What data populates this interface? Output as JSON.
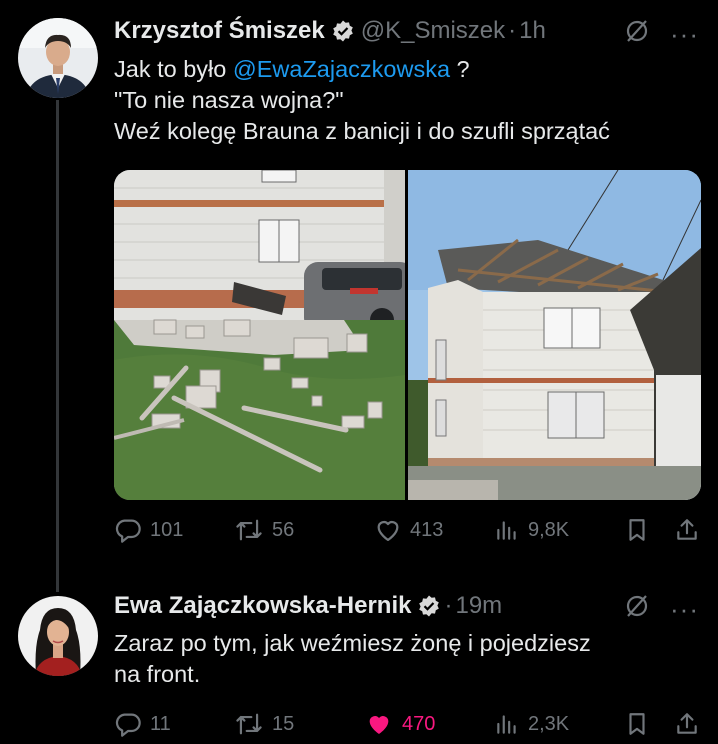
{
  "tweets": [
    {
      "author": "Krzysztof Śmiszek",
      "handle": "@K_Smiszek",
      "dot": "·",
      "time": "1h",
      "text": {
        "line1_pre": "Jak to było ",
        "line1_mention": "@EwaZajaczkowska",
        "line1_post": " ?",
        "line2": "\"To nie nasza wojna?\"",
        "line3": "Weź kolegę Brauna z banicji i do szufli sprzątać"
      },
      "stats": {
        "replies": "101",
        "reposts": "56",
        "likes": "413",
        "views": "9,8K"
      }
    },
    {
      "author": "Ewa Zajączkowska-Hernik",
      "dot": "·",
      "time": "19m",
      "text": {
        "line1": "Zaraz po tym, jak weźmiesz żonę i pojedziesz",
        "line2": "na front."
      },
      "stats": {
        "replies": "11",
        "reposts": "15",
        "likes": "470",
        "views": "2,3K"
      },
      "liked": true
    }
  ],
  "more_label": "···",
  "colors": {
    "accent": "#1d9bf0",
    "like": "#f91880",
    "muted": "#71767b",
    "text": "#e7e9ea",
    "background": "#000000"
  },
  "icons": [
    "verified-badge-icon",
    "grok-icon",
    "more-icon",
    "reply-icon",
    "repost-icon",
    "like-icon",
    "views-icon",
    "bookmark-icon",
    "share-icon"
  ]
}
